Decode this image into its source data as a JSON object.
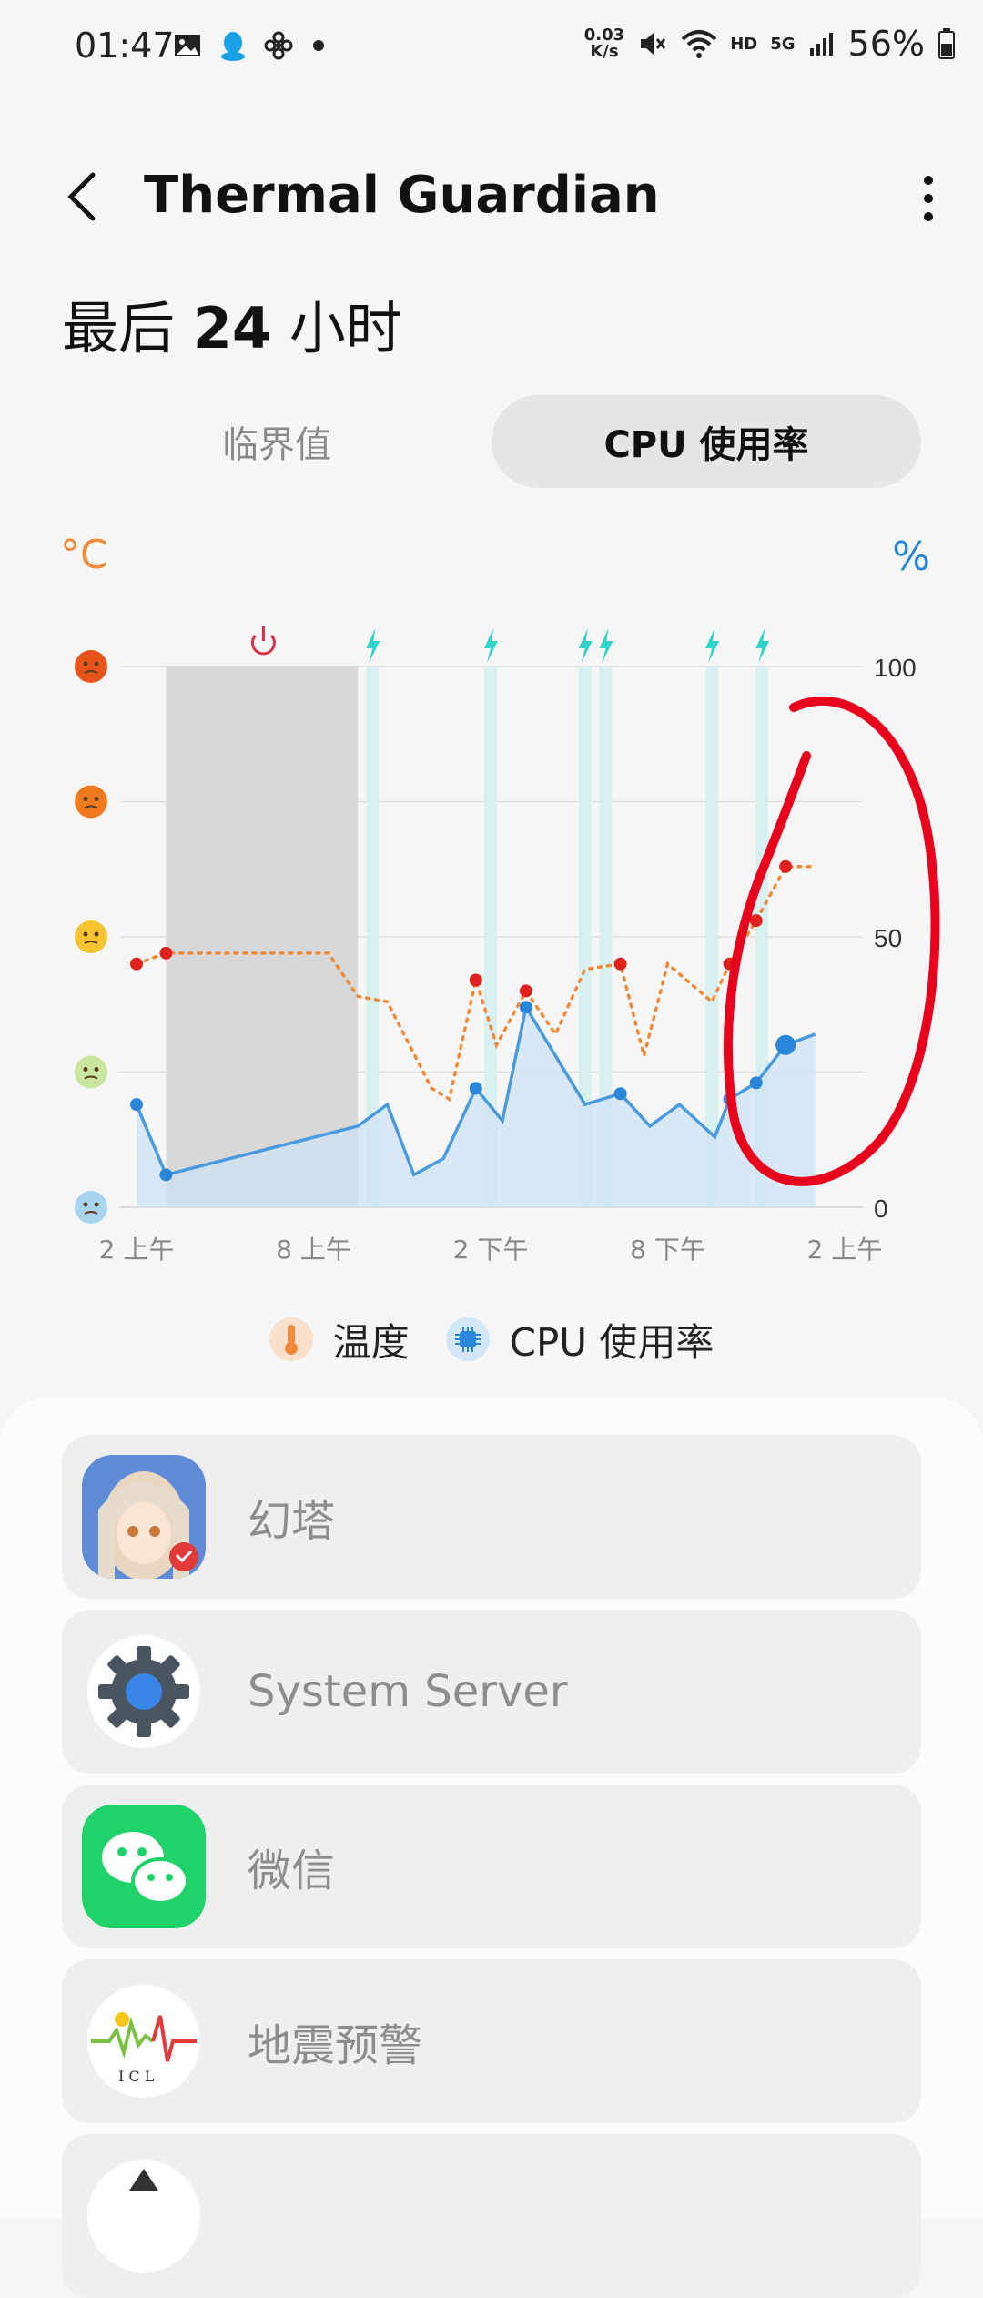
{
  "status_bar": {
    "time": "01:47",
    "speed_value": "0.03",
    "speed_unit": "K/s",
    "hd_label": "HD",
    "net_label": "5G",
    "battery": "56%"
  },
  "header": {
    "title": "Thermal Guardian"
  },
  "range_title": {
    "prefix": "最后",
    "number": "24",
    "suffix": "小时"
  },
  "tabs": [
    {
      "label": "临界值",
      "selected": false
    },
    {
      "label": "CPU 使用率",
      "selected": true
    }
  ],
  "chart_data": {
    "type": "line",
    "left_unit": "°C",
    "right_unit": "%",
    "ylim": [
      0,
      100
    ],
    "y_ticks": [
      "100",
      "50",
      "0"
    ],
    "x_ticks": [
      "2 上午",
      "8 上午",
      "2 下午",
      "8 下午",
      "2 上午"
    ],
    "xlim": [
      0,
      24
    ],
    "shaded_period": [
      1,
      7.5
    ],
    "charging_markers": [
      8,
      12,
      15.2,
      15.9,
      19.5,
      21.2
    ],
    "power_marker": 4.3,
    "series": [
      {
        "name": "温度",
        "color": "#f08a3a",
        "style": "dotted",
        "values": [
          [
            0,
            45
          ],
          [
            1,
            47
          ],
          [
            6.5,
            47
          ],
          [
            7.5,
            39
          ],
          [
            8.5,
            38
          ],
          [
            10,
            22
          ],
          [
            10.6,
            20
          ],
          [
            11.5,
            42
          ],
          [
            12.2,
            30
          ],
          [
            13.2,
            40
          ],
          [
            14.2,
            32
          ],
          [
            15.2,
            44
          ],
          [
            16.4,
            45
          ],
          [
            17.2,
            28
          ],
          [
            18,
            45
          ],
          [
            19.5,
            38
          ],
          [
            20.1,
            45
          ],
          [
            21,
            53
          ],
          [
            22,
            63
          ],
          [
            23,
            63
          ]
        ],
        "markers": [
          [
            0,
            45
          ],
          [
            1,
            47
          ],
          [
            11.5,
            42
          ],
          [
            13.2,
            40
          ],
          [
            16.4,
            45
          ],
          [
            20.1,
            45
          ],
          [
            21,
            53
          ],
          [
            22,
            63
          ]
        ]
      },
      {
        "name": "CPU 使用率",
        "color": "#4a9ae0",
        "style": "solid",
        "values": [
          [
            0,
            19
          ],
          [
            1,
            6
          ],
          [
            7.5,
            15
          ],
          [
            8.5,
            19
          ],
          [
            9.4,
            6
          ],
          [
            10.4,
            9
          ],
          [
            11.5,
            22
          ],
          [
            12.4,
            16
          ],
          [
            13.2,
            37
          ],
          [
            15.2,
            19
          ],
          [
            16.4,
            21
          ],
          [
            17.4,
            15
          ],
          [
            18.4,
            19
          ],
          [
            19.6,
            13
          ],
          [
            20.1,
            20
          ],
          [
            21,
            23
          ],
          [
            22,
            30
          ],
          [
            23,
            32
          ]
        ],
        "markers": [
          [
            0,
            19
          ],
          [
            1,
            6
          ],
          [
            11.5,
            22
          ],
          [
            13.2,
            37
          ],
          [
            16.4,
            21
          ],
          [
            20.1,
            20
          ],
          [
            21,
            23
          ]
        ],
        "current": [
          22,
          30
        ]
      }
    ],
    "left_axis_icons": [
      "hot-face-icon",
      "uneasy-face-icon",
      "neutral-face-icon",
      "relaxed-face-icon",
      "cool-face-icon"
    ],
    "left_axis_colors": [
      "#e6541a",
      "#f07b1e",
      "#f7c531",
      "#c9e6a0",
      "#a8d4ee"
    ],
    "annotation_color": "#e8001c"
  },
  "legend": [
    {
      "label": "温度",
      "icon": "thermometer-icon"
    },
    {
      "label": "CPU 使用率",
      "icon": "cpu-chip-icon"
    }
  ],
  "apps": [
    {
      "name": "幻塔",
      "icon": "tower-of-fantasy-icon"
    },
    {
      "name": "System Server",
      "icon": "settings-gear-icon"
    },
    {
      "name": "微信",
      "icon": "wechat-icon"
    },
    {
      "name": "地震预警",
      "icon": "earthquake-warning-icon"
    }
  ]
}
